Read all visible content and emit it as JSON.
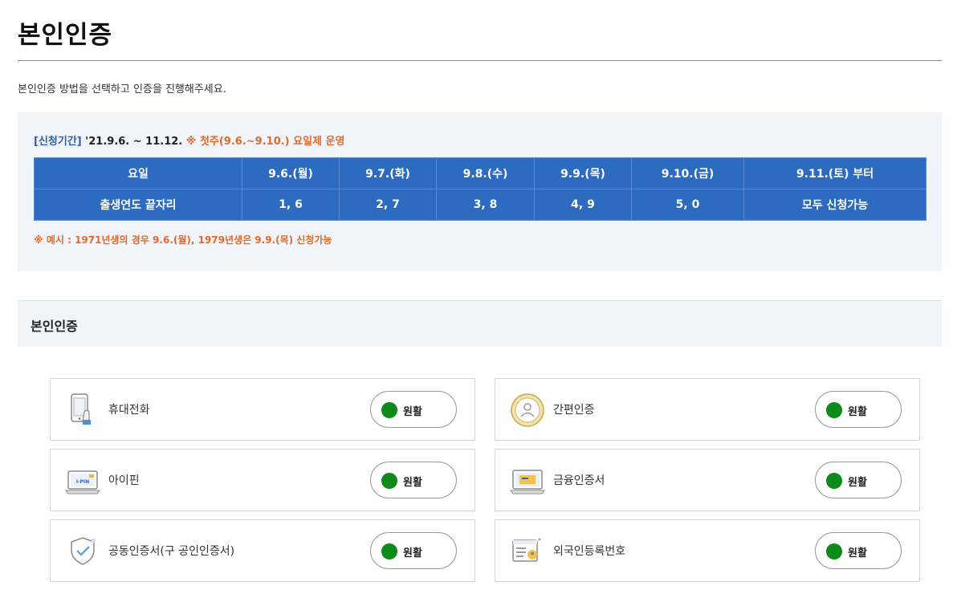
{
  "page": {
    "title": "본인인증",
    "intro": "본인인증 방법을 선택하고 인증을 진행해주세요."
  },
  "notice": {
    "period_label": "[신청기간]",
    "period_dates": "'21.9.6. ~ 11.12.",
    "period_note": "※ 첫주(9.6.~9.10.) 요일제 운영",
    "table": {
      "row1_header": "요일",
      "row2_header": "출생연도 끝자리",
      "days": [
        "9.6.(월)",
        "9.7.(화)",
        "9.8.(수)",
        "9.9.(목)",
        "9.10.(금)",
        "9.11.(토) 부터"
      ],
      "digits": [
        "1, 6",
        "2, 7",
        "3, 8",
        "4, 9",
        "5, 0",
        "모두 신청가능"
      ]
    },
    "example": "※ 예시 : 1971년생의 경우 9.6.(월), 1979년생은 9.9.(목) 신청가능"
  },
  "section": {
    "title": "본인인증"
  },
  "methods": [
    {
      "label": "휴대전화",
      "status": "원활",
      "icon": "mobile-phone-icon"
    },
    {
      "label": "간편인증",
      "status": "원활",
      "icon": "simple-auth-icon"
    },
    {
      "label": "아이핀",
      "status": "원활",
      "icon": "ipin-icon",
      "icon_text": "I-PIN"
    },
    {
      "label": "금융인증서",
      "status": "원활",
      "icon": "financial-certificate-icon"
    },
    {
      "label": "공동인증서(구 공인인증서)",
      "status": "원활",
      "icon": "joint-certificate-icon"
    },
    {
      "label": "외국인등록번호",
      "status": "원활",
      "icon": "alien-registration-icon"
    }
  ],
  "colors": {
    "accent_blue": "#2c6bbf",
    "note_orange": "#e56a2a",
    "status_green": "#0e8a1a",
    "panel_bg": "#f1f4f9"
  }
}
